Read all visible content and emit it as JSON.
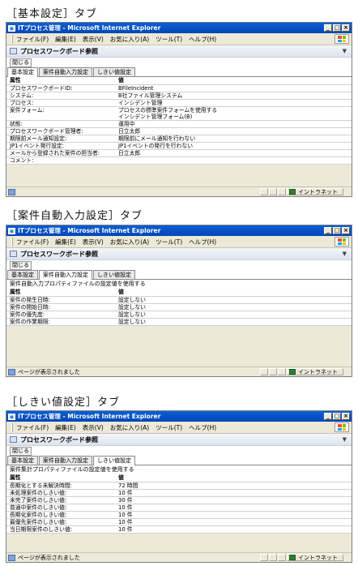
{
  "window": {
    "title": "ITプロセス管理 - Microsoft Internet Explorer",
    "menu": [
      "ファイル(F)",
      "編集(E)",
      "表示(V)",
      "お気に入り(A)",
      "ツール(T)",
      "ヘルプ(H)"
    ],
    "page_header": "プロセスワークボード参照",
    "close_label": "閉じる",
    "tabs": [
      "基本設定",
      "案件自動入力設定",
      "しきい値設定"
    ],
    "zone": "イントラネット",
    "status_done": "ページが表示されました"
  },
  "sections": [
    {
      "title": "［基本設定］タブ",
      "header": [
        "属性",
        "値"
      ],
      "rows": [
        [
          "プロセスワークボードID:",
          "BFileIncident"
        ],
        [
          "システム:",
          "B社ファイル管理システム"
        ],
        [
          "プロセス:",
          "インシデント管理"
        ],
        [
          "案件フォーム:",
          "プロセスの標準案件フォームを使用する"
        ],
        [
          "",
          "インシデント管理フォーム(B)"
        ],
        [
          "状態:",
          "運用中"
        ],
        [
          "プロセスワークボード管理者:",
          "日立太郎"
        ],
        [
          "期限前メール通知設定:",
          "期限前にメール通知を行わない"
        ],
        [
          "JP1イベント発行設定:",
          "JP1イベントの発行を行わない"
        ],
        [
          "メールから登録された案件の担当者:",
          "日立太郎"
        ],
        [
          "コメント:",
          ""
        ]
      ]
    },
    {
      "title": "［案件自動入力設定］タブ",
      "note": "案件自動入力プロパティファイルの設定値を使用する",
      "header": [
        "属性",
        "値"
      ],
      "rows": [
        [
          "案件の発生日時:",
          "設定しない"
        ],
        [
          "案件の開始日時:",
          "設定しない"
        ],
        [
          "案件の優先度:",
          "設定しない"
        ],
        [
          "案件の作業期限:",
          "設定しない"
        ]
      ]
    },
    {
      "title": "［しきい値設定］タブ",
      "note": "案件集計プロパティファイルの設定値を使用する",
      "header": [
        "属性",
        "値"
      ],
      "rows": [
        [
          "長期化とする未解決時間:",
          "72 時間"
        ],
        [
          "未処理案件のしきい値:",
          "10 件"
        ],
        [
          "未完了案件のしきい値:",
          "30 件"
        ],
        [
          "普通中案件のしきい値:",
          "10 件"
        ],
        [
          "長期化案件のしきい値:",
          "10 件"
        ],
        [
          "最優先案件のしきい値:",
          "10 件"
        ],
        [
          "当日期限案件のしきい値:",
          "10 件"
        ]
      ]
    }
  ]
}
